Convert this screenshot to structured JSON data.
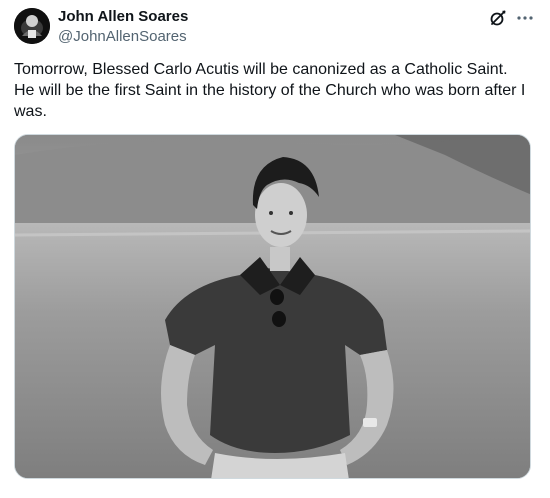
{
  "author": {
    "display_name": "John Allen Soares",
    "handle": "@JohnAllenSoares",
    "avatar_icon": "profile-avatar"
  },
  "header_actions": {
    "grok_icon": "grok-icon",
    "more_icon": "more-horizontal-icon"
  },
  "tweet": {
    "text": "Tomorrow, Blessed Carlo Acutis will be canonized as a Catholic Saint.\nHe will be the first Saint in the history of the Church who was born after I\nwas."
  },
  "media": {
    "kind": "black-and-white photo",
    "subject": "young man in polo shirt standing in a grassy field with hills behind"
  },
  "colors": {
    "text_primary": "#0f1419",
    "text_secondary": "#536471",
    "border": "#cfd9de"
  }
}
